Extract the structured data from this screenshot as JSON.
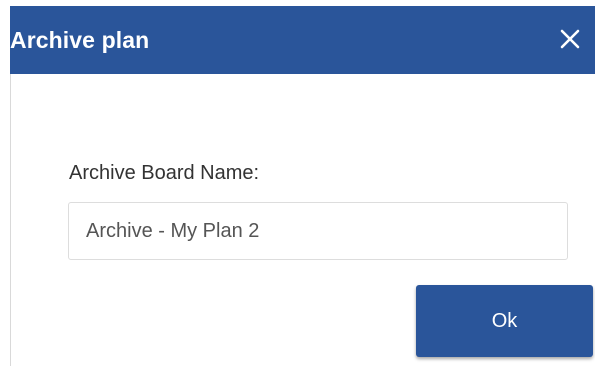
{
  "dialog": {
    "title": "Archive plan",
    "close_icon": "close-icon",
    "field_label": "Archive Board Name:",
    "board_name_value": "Archive - My Plan 2",
    "ok_label": "Ok"
  },
  "colors": {
    "accent": "#2a559a",
    "title_text": "#ffffff"
  }
}
